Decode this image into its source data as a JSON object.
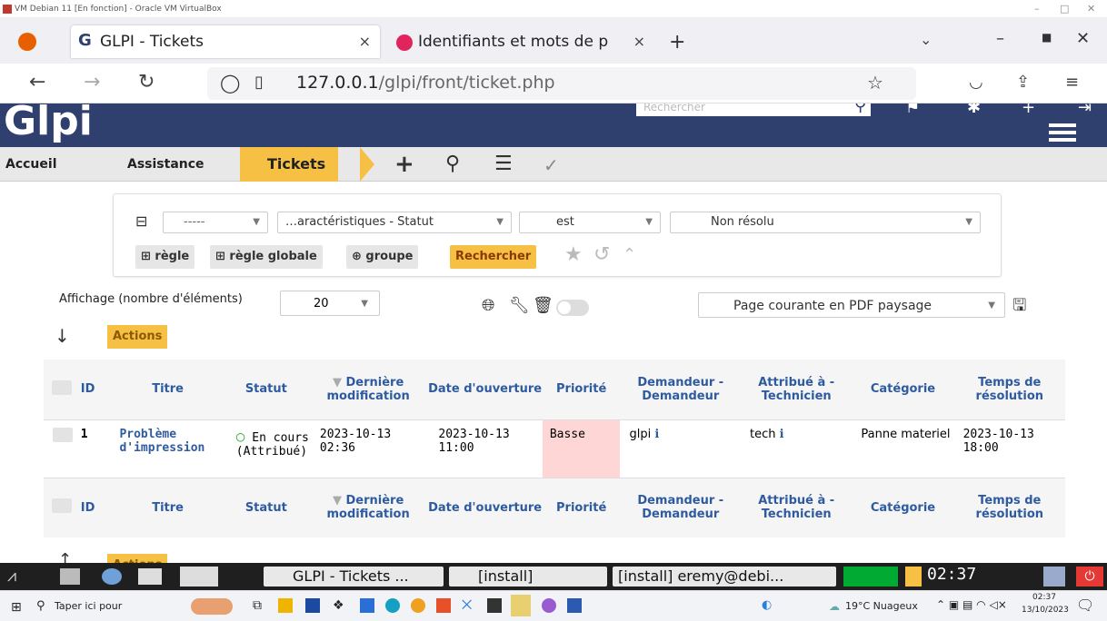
{
  "vbox": {
    "title": "VM Debian 11 [En fonction] - Oracle VM VirtualBox"
  },
  "browser": {
    "tabs": [
      {
        "label": "GLPI - Tickets"
      },
      {
        "label": "Identifiants et mots de p"
      }
    ],
    "new_tab": "+",
    "url_host": "127.0.0.1",
    "url_path": "/glpi/front/ticket.php"
  },
  "glpi": {
    "logo": "Glpi",
    "search_placeholder": "Rechercher",
    "breadcrumb": {
      "home": "Accueil",
      "assistance": "Assistance",
      "tickets": "Tickets"
    },
    "criteria": {
      "link": "-----",
      "field": "…aractéristiques - Statut",
      "operator": "est",
      "value": "Non résolu"
    },
    "buttons": {
      "rule": "règle",
      "global_rule": "règle globale",
      "group": "groupe",
      "search": "Rechercher"
    },
    "display_label": "Affichage (nombre d'éléments)",
    "display_count": "20",
    "export_option": "Page courante en PDF paysage",
    "actions": "Actions",
    "columns": [
      "ID",
      "Titre",
      "Statut",
      "Dernière modification",
      "Date d'ouverture",
      "Priorité",
      "Demandeur - Demandeur",
      "Attribué à - Technicien",
      "Catégorie",
      "Temps de résolution"
    ],
    "rows": [
      {
        "id": "1",
        "title": "Problème d'impression",
        "status": "En cours (Attribué)",
        "modified": "2023-10-13 02:36",
        "opened": "2023-10-13 11:00",
        "priority": "Basse",
        "requester": "glpi",
        "technician": "tech",
        "category": "Panne materiel",
        "resolution": "2023-10-13 18:00"
      }
    ],
    "priority_color": "#ffd6d6",
    "accent": "#f6c044",
    "header_color": "#2f3f6e"
  },
  "lx_taskbar": {
    "items": [
      "GLPI - Tickets ...",
      "[install]",
      "[install] eremy@debi..."
    ],
    "clock": "02:37"
  },
  "win_taskbar": {
    "search": "Taper ici pour",
    "weather": "19°C Nuageux",
    "time": "02:37",
    "date": "13/10/2023"
  }
}
